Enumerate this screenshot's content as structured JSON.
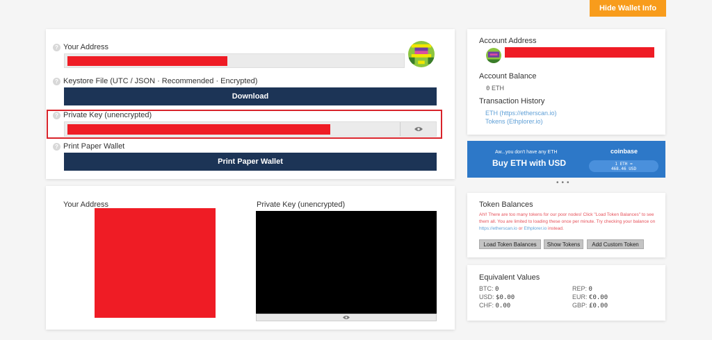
{
  "header": {
    "hide_label": "Hide Wallet Info"
  },
  "wallet": {
    "address_label": "Your Address",
    "keystore_label": "Keystore File (UTC / JSON · Recommended · Encrypted)",
    "download_label": "Download",
    "private_key_label": "Private Key (unencrypted)",
    "print_label": "Print Paper Wallet",
    "print_button": "Print Paper Wallet"
  },
  "paper": {
    "address_label": "Your Address",
    "private_key_label": "Private Key (unencrypted)"
  },
  "account": {
    "address_label": "Account Address",
    "balance_label": "Account Balance",
    "balance_value": "0",
    "balance_unit": "ETH",
    "history_label": "Transaction History",
    "history_links": [
      "ETH (https://etherscan.io)",
      "Tokens (Ethplorer.io)"
    ]
  },
  "promo": {
    "tagline": "Aw...you don't have any ETH",
    "cta": "Buy ETH with USD",
    "brand": "coinbase",
    "rate_line1": "1 ETH ≈",
    "rate_line2": "468.46 USD"
  },
  "tokens": {
    "title": "Token Balances",
    "warning_line1": "Ah!! There are too many tokens for our poor nodes! Click \"Load Token Balances\" to see",
    "warning_line2": "them all. You are limited to loading these once per minute. Try checking your balance on",
    "warning_line3_a": "https://etherscan.io",
    "warning_line3_b": " or ",
    "warning_line3_c": "Ethplorer.io",
    "warning_line3_d": " instead.",
    "buttons": [
      "Load Token Balances",
      "Show Tokens",
      "Add Custom Token"
    ]
  },
  "equivalent": {
    "title": "Equivalent Values",
    "rows": [
      {
        "label": "BTC:",
        "value": "0"
      },
      {
        "label": "REP:",
        "value": "0"
      },
      {
        "label": "USD:",
        "value": "$0.00"
      },
      {
        "label": "EUR:",
        "value": "€0.00"
      },
      {
        "label": "CHF:",
        "value": "0.00"
      },
      {
        "label": "GBP:",
        "value": "£0.00"
      }
    ]
  },
  "colors": {
    "accent": "#f89c1c",
    "navy": "#1c3456",
    "redacted": "#ef1c25",
    "promo": "#2d78c8"
  }
}
